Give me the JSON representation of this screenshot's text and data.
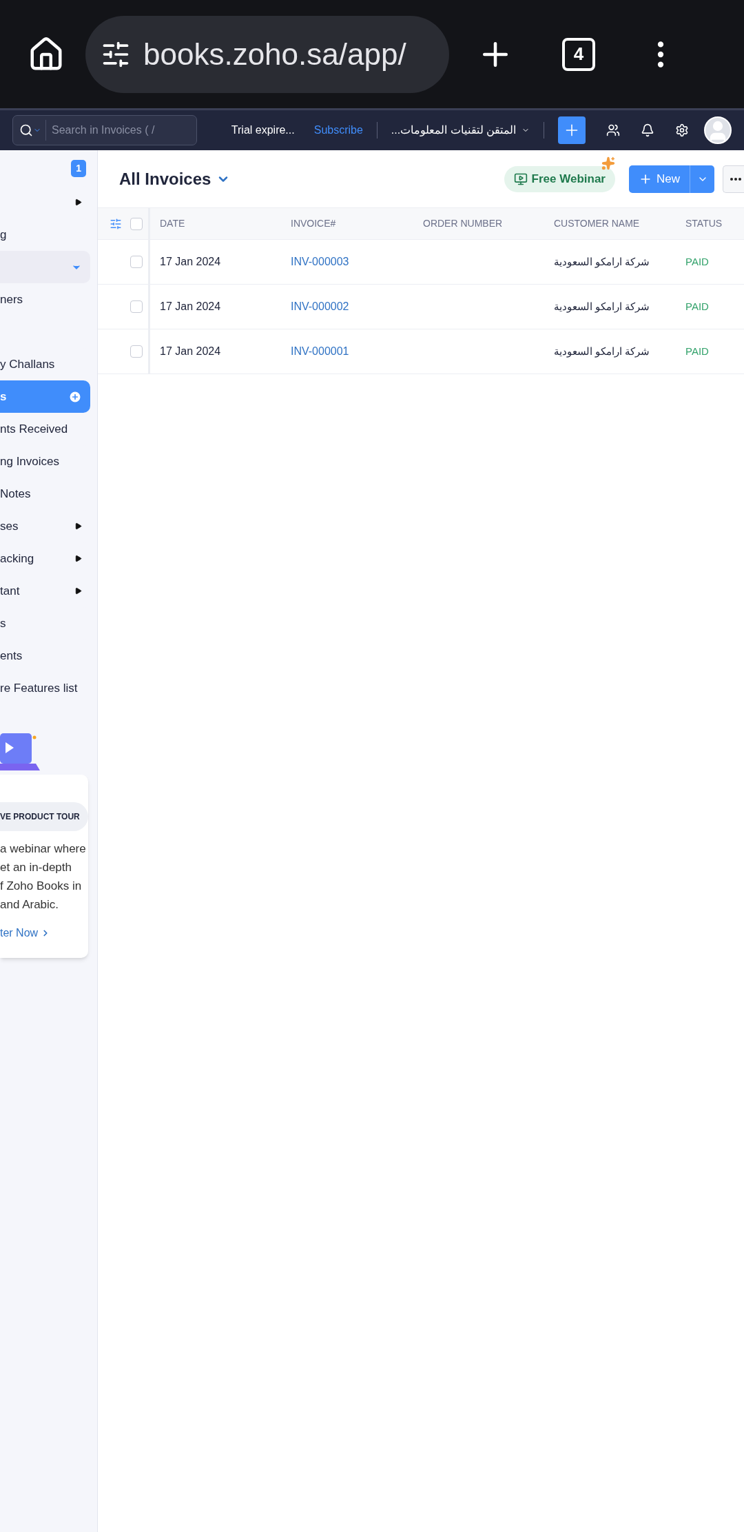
{
  "browser": {
    "url": "books.zoho.sa/app/",
    "tab_count": "4"
  },
  "header": {
    "search_placeholder": "Search in Invoices ( /",
    "trial": "Trial expire...",
    "subscribe": "Subscribe",
    "organization": "...المتقن لتقنيات المعلومات"
  },
  "sidebar": {
    "items": [
      {
        "kind": "badge",
        "badge": "1"
      },
      {
        "kind": "submenu",
        "selected": false
      },
      {
        "kind": "link",
        "label": "g",
        "selected": false
      },
      {
        "kind": "group",
        "expanded": true
      },
      {
        "kind": "link",
        "label": "ners",
        "selected": false
      },
      {
        "kind": "spacer"
      },
      {
        "kind": "link",
        "label": "y Challans",
        "selected": false
      },
      {
        "kind": "link",
        "label": "s",
        "selected": true
      },
      {
        "kind": "link",
        "label": "nts Received",
        "selected": false
      },
      {
        "kind": "link",
        "label": "ng Invoices",
        "selected": false
      },
      {
        "kind": "link",
        "label": "Notes",
        "selected": false
      },
      {
        "kind": "submenu",
        "label": "ses",
        "selected": false
      },
      {
        "kind": "submenu",
        "label": "acking",
        "selected": false
      },
      {
        "kind": "submenu",
        "label": "tant",
        "selected": false
      },
      {
        "kind": "link",
        "label": "s",
        "selected": false
      },
      {
        "kind": "link",
        "label": "ents",
        "selected": false
      },
      {
        "kind": "link",
        "label": "re Features list",
        "selected": false
      }
    ]
  },
  "promo": {
    "tag": "VE PRODUCT TOUR",
    "text": "a webinar where\net an in-depth\nf Zoho Books in\nand Arabic.",
    "link": "ter Now"
  },
  "page": {
    "title": "All Invoices",
    "webinar": "Free Webinar",
    "new_button": "New"
  },
  "table": {
    "all_checked": false,
    "columns": [
      "DATE",
      "INVOICE#",
      "ORDER NUMBER",
      "CUSTOMER NAME",
      "STATUS"
    ],
    "rows": [
      {
        "checked": false,
        "date": "17 Jan 2024",
        "invoice": "INV-000003",
        "customer": "شركة ارامكو السعودية",
        "status": "PAID"
      },
      {
        "checked": false,
        "date": "17 Jan 2024",
        "invoice": "INV-000002",
        "customer": "شركة ارامكو السعودية",
        "status": "PAID"
      },
      {
        "checked": false,
        "date": "17 Jan 2024",
        "invoice": "INV-000001",
        "customer": "شركة ارامكو السعودية",
        "status": "PAID"
      }
    ]
  }
}
